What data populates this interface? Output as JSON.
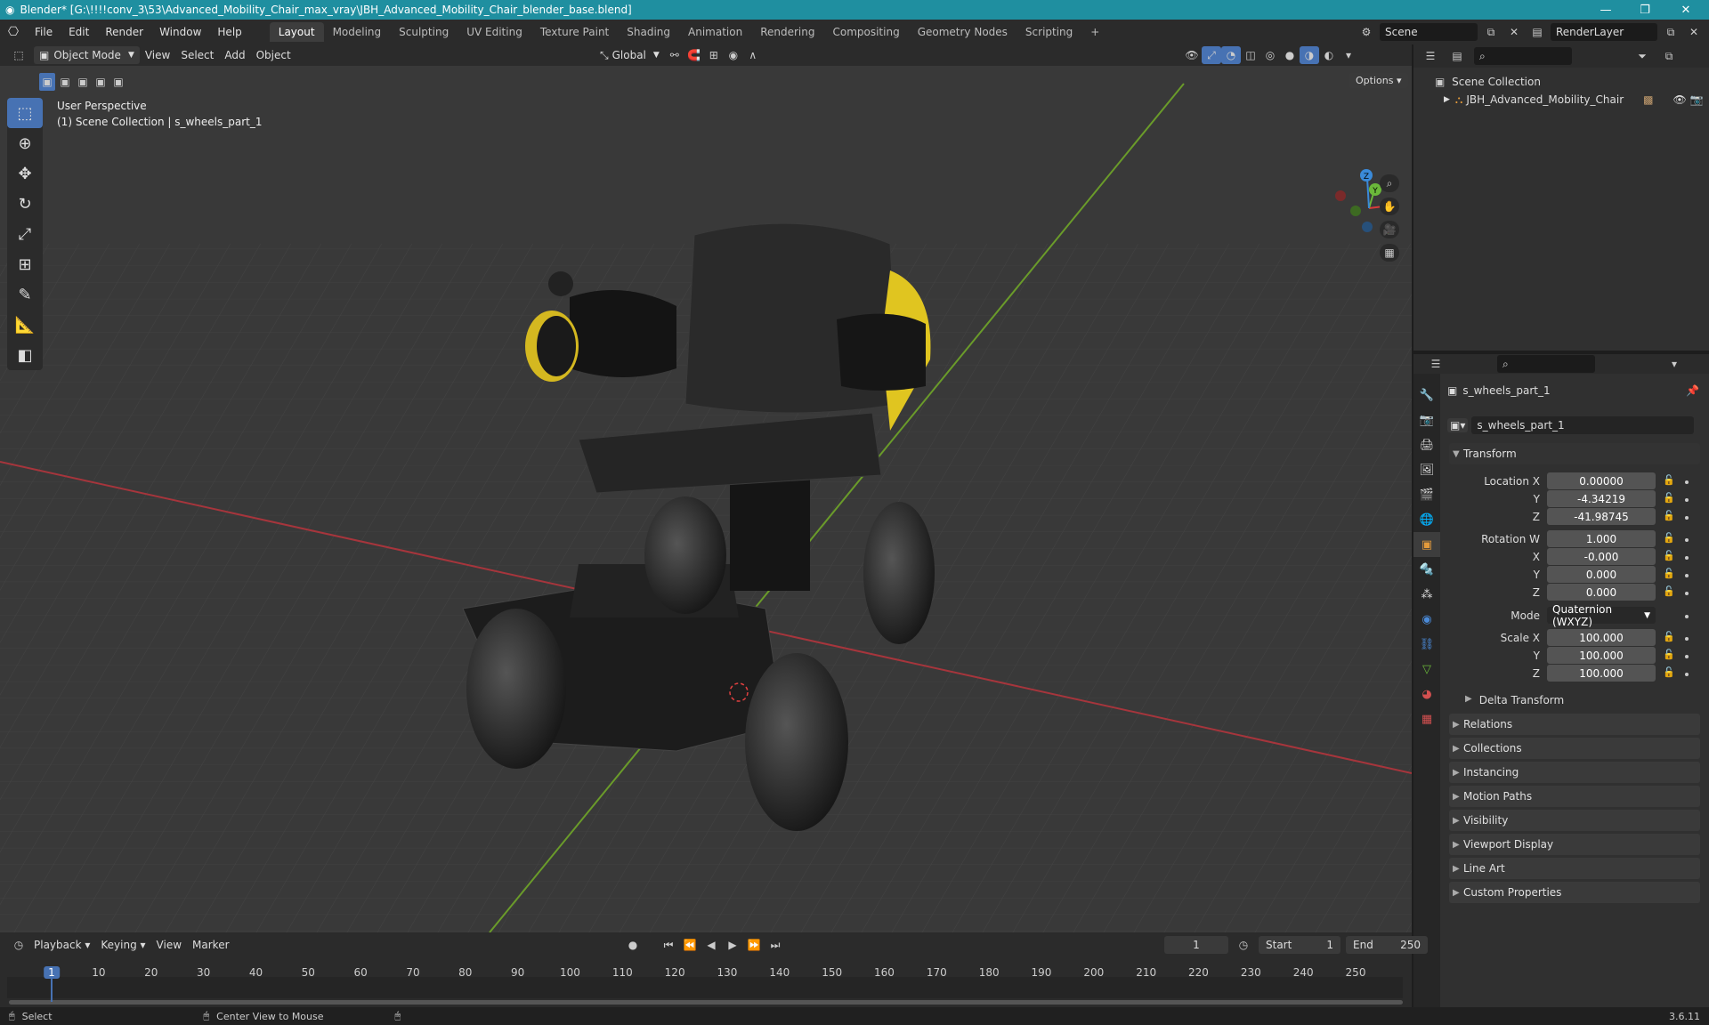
{
  "window": {
    "title": "Blender* [G:\\!!!!conv_3\\53\\Advanced_Mobility_Chair_max_vray\\JBH_Advanced_Mobility_Chair_blender_base.blend]",
    "min": "—",
    "max": "❐",
    "close": "✕"
  },
  "menu": {
    "items": [
      "File",
      "Edit",
      "Render",
      "Window",
      "Help"
    ]
  },
  "workspaces": [
    "Layout",
    "Modeling",
    "Sculpting",
    "UV Editing",
    "Texture Paint",
    "Shading",
    "Animation",
    "Rendering",
    "Compositing",
    "Geometry Nodes",
    "Scripting"
  ],
  "scene": {
    "name": "Scene",
    "renderlayer": "RenderLayer"
  },
  "viewport_header": {
    "mode": "Object Mode",
    "view": "View",
    "select": "Select",
    "add": "Add",
    "object": "Object",
    "orientation": "Global",
    "options": "Options"
  },
  "viewport": {
    "perspective": "User Perspective",
    "collection": "(1) Scene Collection | s_wheels_part_1"
  },
  "gizmo": {
    "x": "X",
    "y": "Y",
    "z": "Z"
  },
  "outliner": {
    "root": "Scene Collection",
    "item": "JBH_Advanced_Mobility_Chair"
  },
  "properties": {
    "object_name": "s_wheels_part_1",
    "datablock": "s_wheels_part_1",
    "transform": "Transform",
    "location_label": "Location X",
    "loc_x": "0.00000",
    "loc_y": "-4.34219",
    "loc_z": "-41.98745",
    "rotation_label": "Rotation W",
    "rot_w": "1.000",
    "rot_x": "-0.000",
    "rot_y": "0.000",
    "rot_z": "0.000",
    "mode_label": "Mode",
    "mode_value": "Quaternion (WXYZ)",
    "scale_label": "Scale X",
    "scale_x": "100.000",
    "scale_y": "100.000",
    "scale_z": "100.000",
    "y": "Y",
    "z": "Z",
    "x": "X",
    "delta": "Delta Transform",
    "panels": [
      "Relations",
      "Collections",
      "Instancing",
      "Motion Paths",
      "Visibility",
      "Viewport Display",
      "Line Art",
      "Custom Properties"
    ]
  },
  "timeline": {
    "playback": "Playback",
    "keying": "Keying",
    "view": "View",
    "marker": "Marker",
    "current_frame": "1",
    "start_label": "Start",
    "start": "1",
    "end_label": "End",
    "end": "250",
    "ticks": [
      "1",
      "10",
      "20",
      "30",
      "40",
      "50",
      "60",
      "70",
      "80",
      "90",
      "100",
      "110",
      "120",
      "130",
      "140",
      "150",
      "160",
      "170",
      "180",
      "190",
      "200",
      "210",
      "220",
      "230",
      "240",
      "250"
    ]
  },
  "status": {
    "select": "Select",
    "center": "Center View to Mouse",
    "version": "3.6.11"
  },
  "colors": {
    "accent": "#4772b3",
    "title_bar": "#1f8fa0",
    "x_axis": "#d93b3b",
    "y_axis": "#6bb83a",
    "z_axis": "#3a8ad9"
  }
}
